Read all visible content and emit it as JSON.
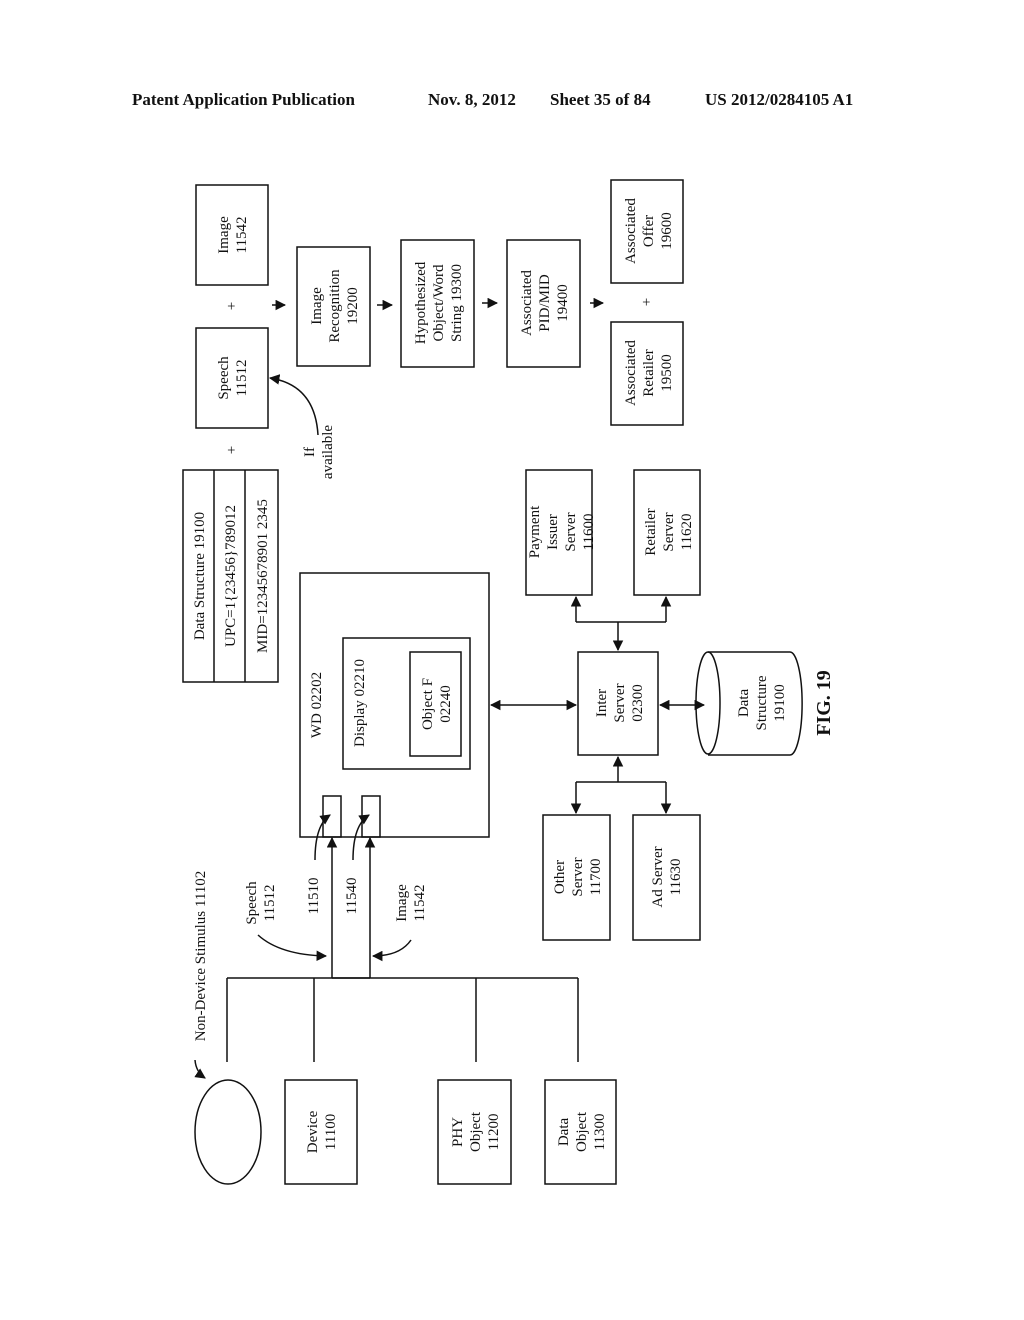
{
  "header": {
    "publication": "Patent Application Publication",
    "date": "Nov. 8, 2012",
    "sheet": "Sheet 35 of 84",
    "number": "US 2012/0284105 A1"
  },
  "figure": {
    "label": "FIG. 19",
    "boxes": {
      "image_top": [
        "Image",
        "11542"
      ],
      "speech_top": [
        "Speech",
        "11512"
      ],
      "image_recognition": [
        "Image",
        "Recognition",
        "19200"
      ],
      "hypothesized": [
        "Hypothesized",
        "Object/Word",
        "String 19300"
      ],
      "associated_pid": [
        "Associated",
        "PID/MID",
        "19400"
      ],
      "associated_offer": [
        "Associated",
        "Offer",
        "19600"
      ],
      "associated_retailer": [
        "Associated",
        "Retailer",
        "19500"
      ],
      "data_structure_table": [
        "Data Structure 19100",
        "UPC=1{23456}789012",
        "MID=12345678901 2345"
      ],
      "wd": "WD 02202",
      "display": "Display 02210",
      "object_f": [
        "Object F",
        "02240"
      ],
      "payment_issuer": [
        "Payment",
        "Issuer",
        "Server",
        "11600"
      ],
      "retailer_server": [
        "Retailer",
        "Server",
        "11620"
      ],
      "inter_server": [
        "Inter",
        "Server",
        "02300"
      ],
      "data_structure_db": [
        "Data",
        "Structure",
        "19100"
      ],
      "other_server": [
        "Other",
        "Server",
        "11700"
      ],
      "ad_server": [
        "Ad Server",
        "11630"
      ],
      "device": [
        "Device",
        "11100"
      ],
      "phy_object": [
        "PHY",
        "Object",
        "11200"
      ],
      "data_object": [
        "Data",
        "Object",
        "11300"
      ]
    },
    "labels": {
      "if_available": [
        "If",
        "available"
      ],
      "plus": "+",
      "non_device_stimulus": "Non-Device Stimulus 11102",
      "speech_in": [
        "Speech",
        "11512"
      ],
      "image_in": [
        "Image",
        "11542"
      ],
      "port_11510": "11510",
      "port_11540": "11540"
    }
  }
}
